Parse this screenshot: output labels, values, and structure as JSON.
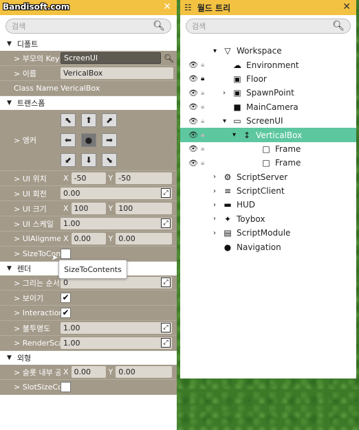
{
  "watermark": "Bandisoft.com",
  "props": {
    "title": "",
    "search_placeholder": "검색",
    "sections": {
      "default": "디폴트",
      "transform": "트랜스폼",
      "render": "렌더",
      "appearance": "외형"
    },
    "parent_key": {
      "label": "> 부모의 Key",
      "value": "ScreenUI"
    },
    "name": {
      "label": "> 이름",
      "value": "VericalBox"
    },
    "classname": {
      "label": "Class Name",
      "value": "VericalBox"
    },
    "anchor": {
      "label": "> 앵커",
      "buttons": [
        "⬉",
        "⬆",
        "⬈",
        "⬅",
        "●",
        "➡",
        "⬋",
        "⬇",
        "⬊"
      ]
    },
    "ui_pos": {
      "label": "> UI 위치",
      "x": "-50",
      "y": "-50"
    },
    "ui_rot": {
      "label": "> UI 회전",
      "value": "0.00"
    },
    "ui_size": {
      "label": "> UI 크기",
      "x": "100",
      "y": "100"
    },
    "ui_scale": {
      "label": "> UI 스케일",
      "value": "1.00"
    },
    "ui_align": {
      "label": "> UIAlignmen",
      "x": "0.00",
      "y": "0.00"
    },
    "size_to": {
      "label": "> SizeToConte"
    },
    "tooltip": "SizeToContents",
    "draw_order": {
      "label": "> 그리는 순서",
      "value": "0"
    },
    "visible": {
      "label": "> 보이기"
    },
    "interaction": {
      "label": "> Interaction"
    },
    "opacity": {
      "label": "> 불투명도",
      "value": "1.00"
    },
    "render_scale": {
      "label": "> RenderSca",
      "value": "1.00"
    },
    "slot_padding": {
      "label": "> 슬롯 내부 공",
      "x": "0.00",
      "y": "0.00"
    },
    "slot_size": {
      "label": "> SlotSizeCon"
    }
  },
  "tree": {
    "title": "월드 트리",
    "search_placeholder": "검색",
    "items": [
      {
        "name": "Workspace",
        "icon": "▽"
      },
      {
        "name": "Environment",
        "icon": "☁"
      },
      {
        "name": "Floor",
        "icon": "▣"
      },
      {
        "name": "SpawnPoint",
        "icon": "▣"
      },
      {
        "name": "MainCamera",
        "icon": "■"
      },
      {
        "name": "ScreenUI",
        "icon": "▭"
      },
      {
        "name": "VerticalBox",
        "icon": "↕"
      },
      {
        "name": "Frame",
        "icon": "□"
      },
      {
        "name": "Frame",
        "icon": "□"
      },
      {
        "name": "ScriptServer",
        "icon": "⚙"
      },
      {
        "name": "ScriptClient",
        "icon": "≡"
      },
      {
        "name": "HUD",
        "icon": "▬"
      },
      {
        "name": "Toybox",
        "icon": "✦"
      },
      {
        "name": "ScriptModule",
        "icon": "▤"
      },
      {
        "name": "Navigation",
        "icon": "●"
      }
    ]
  }
}
